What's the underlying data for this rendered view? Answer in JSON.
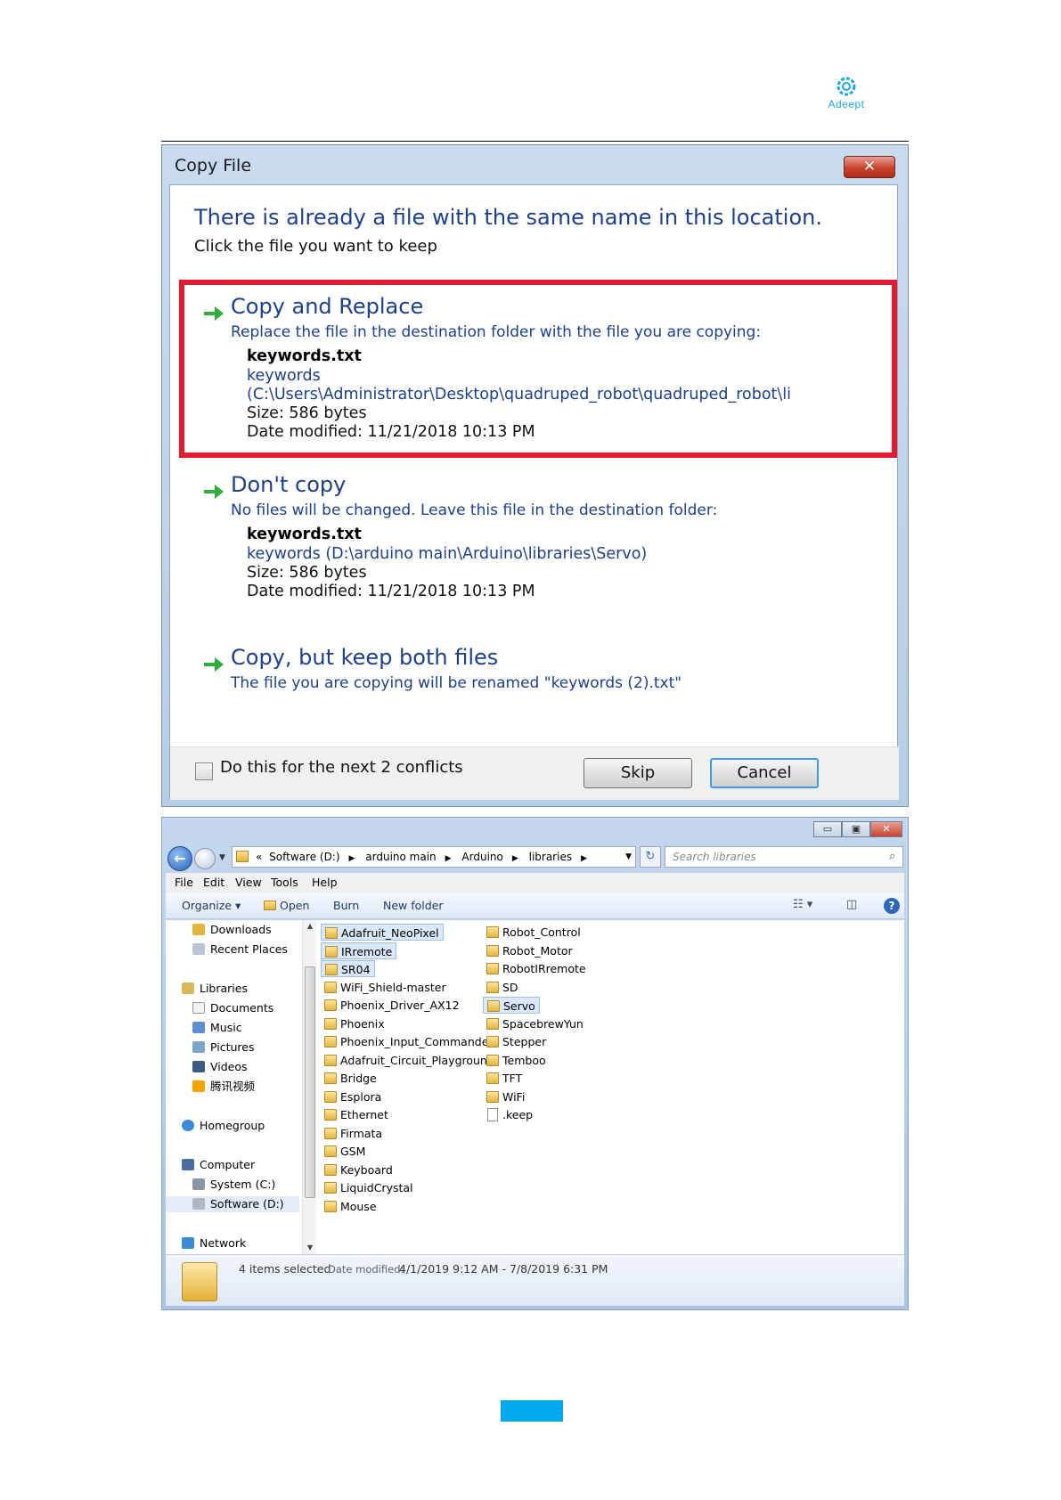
{
  "logo": {
    "text": "Adeept"
  },
  "dialog": {
    "title": "Copy File",
    "close_glyph": "✕",
    "headline": "There is already a file with the same name in this location.",
    "subhead": "Click the file you want to keep",
    "options": [
      {
        "title": "Copy and Replace",
        "description": "Replace the file in the destination folder with the file you are copying:",
        "file_name": "keywords.txt",
        "link_line1": "keywords",
        "link_line2": "(C:\\Users\\Administrator\\Desktop\\quadruped_robot\\quadruped_robot\\li",
        "size": "Size: 586 bytes",
        "date": "Date modified: 11/21/2018 10:13 PM",
        "highlighted": true
      },
      {
        "title": "Don't copy",
        "description": "No files will be changed. Leave this file in the destination folder:",
        "file_name": "keywords.txt",
        "link_line1": "keywords (D:\\arduino main\\Arduino\\libraries\\Servo)",
        "size": "Size: 586 bytes",
        "date": "Date modified: 11/21/2018 10:13 PM"
      },
      {
        "title": "Copy, but keep both files",
        "description": "The file you are copying will be renamed \"keywords (2).txt\""
      }
    ],
    "checkbox_label": "Do this for the next 2 conflicts",
    "checkbox_checked": false,
    "skip_label": "Skip",
    "cancel_label": "Cancel",
    "highlight_color": "#e21b2e"
  },
  "explorer": {
    "window_buttons": {
      "minimize": "▭",
      "maximize": "▣",
      "close": "✕"
    },
    "breadcrumb": [
      "«",
      "Software (D:)",
      "arduino main",
      "Arduino",
      "libraries"
    ],
    "search_placeholder": "Search libraries",
    "menu": [
      "File",
      "Edit",
      "View",
      "Tools",
      "Help"
    ],
    "toolbar": {
      "organize": "Organize ▾",
      "open": "Open",
      "burn": "Burn",
      "new_folder": "New folder"
    },
    "nav": {
      "favorites": [
        "Downloads",
        "Recent Places"
      ],
      "libraries_header": "Libraries",
      "libraries": [
        "Documents",
        "Music",
        "Pictures",
        "Videos",
        "腾讯视频"
      ],
      "homegroup": "Homegroup",
      "computer_header": "Computer",
      "computer": [
        "System (C:)",
        "Software (D:)"
      ],
      "network": "Network"
    },
    "files_col1": [
      {
        "name": "Adafruit_NeoPixel",
        "selected": true
      },
      {
        "name": "IRremote",
        "selected": true
      },
      {
        "name": "SR04",
        "selected": true
      },
      {
        "name": "WiFi_Shield-master"
      },
      {
        "name": "Phoenix_Driver_AX12"
      },
      {
        "name": "Phoenix"
      },
      {
        "name": "Phoenix_Input_Commander"
      },
      {
        "name": "Adafruit_Circuit_Playground"
      },
      {
        "name": "Bridge"
      },
      {
        "name": "Esplora"
      },
      {
        "name": "Ethernet"
      },
      {
        "name": "Firmata"
      },
      {
        "name": "GSM"
      },
      {
        "name": "Keyboard"
      },
      {
        "name": "LiquidCrystal"
      },
      {
        "name": "Mouse"
      }
    ],
    "files_col2": [
      {
        "name": "Robot_Control"
      },
      {
        "name": "Robot_Motor"
      },
      {
        "name": "RobotIRremote"
      },
      {
        "name": "SD"
      },
      {
        "name": "Servo",
        "selected": true
      },
      {
        "name": "SpacebrewYun"
      },
      {
        "name": "Stepper"
      },
      {
        "name": "Temboo"
      },
      {
        "name": "TFT"
      },
      {
        "name": "WiFi"
      },
      {
        "name": ".keep",
        "type": "file"
      }
    ],
    "details": {
      "selection": "4 items selected",
      "date_label": "Date modified:",
      "date_value": "4/1/2019 9:12 AM - 7/8/2019 6:31 PM"
    }
  }
}
